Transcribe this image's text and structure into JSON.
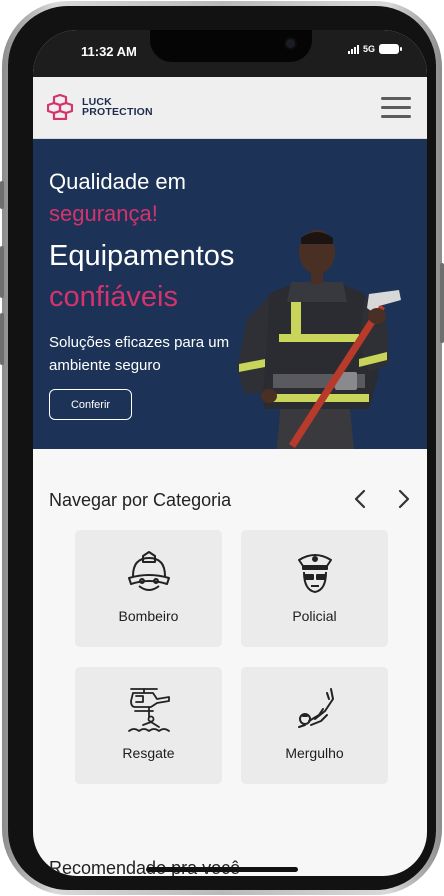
{
  "status_bar": {
    "time": "11:32 AM",
    "network": "5G"
  },
  "header": {
    "logo_line1": "LUCK",
    "logo_line2": "PROTECTION",
    "brand_color": "#d6336c",
    "menu_icon": "hamburger-menu-icon"
  },
  "hero": {
    "subtitle_line1": "Qualidade em",
    "subtitle_line2": "segurança!",
    "title_line1": "Equipamentos",
    "title_line2": "confiáveis",
    "description": "Soluções eficazes para um ambiente seguro",
    "cta_label": "Conferir",
    "background_color": "#1c3357",
    "accent_color": "#d6336c"
  },
  "categories": {
    "title": "Navegar por Categoria",
    "prev_icon": "chevron-left-icon",
    "next_icon": "chevron-right-icon",
    "items": [
      {
        "label": "Bombeiro",
        "icon": "firefighter-helmet-icon"
      },
      {
        "label": "Policial",
        "icon": "police-officer-icon"
      },
      {
        "label": "Resgate",
        "icon": "rescue-helicopter-icon"
      },
      {
        "label": "Mergulho",
        "icon": "diver-icon"
      }
    ]
  },
  "recommended": {
    "title": "Recomendado pra você"
  }
}
